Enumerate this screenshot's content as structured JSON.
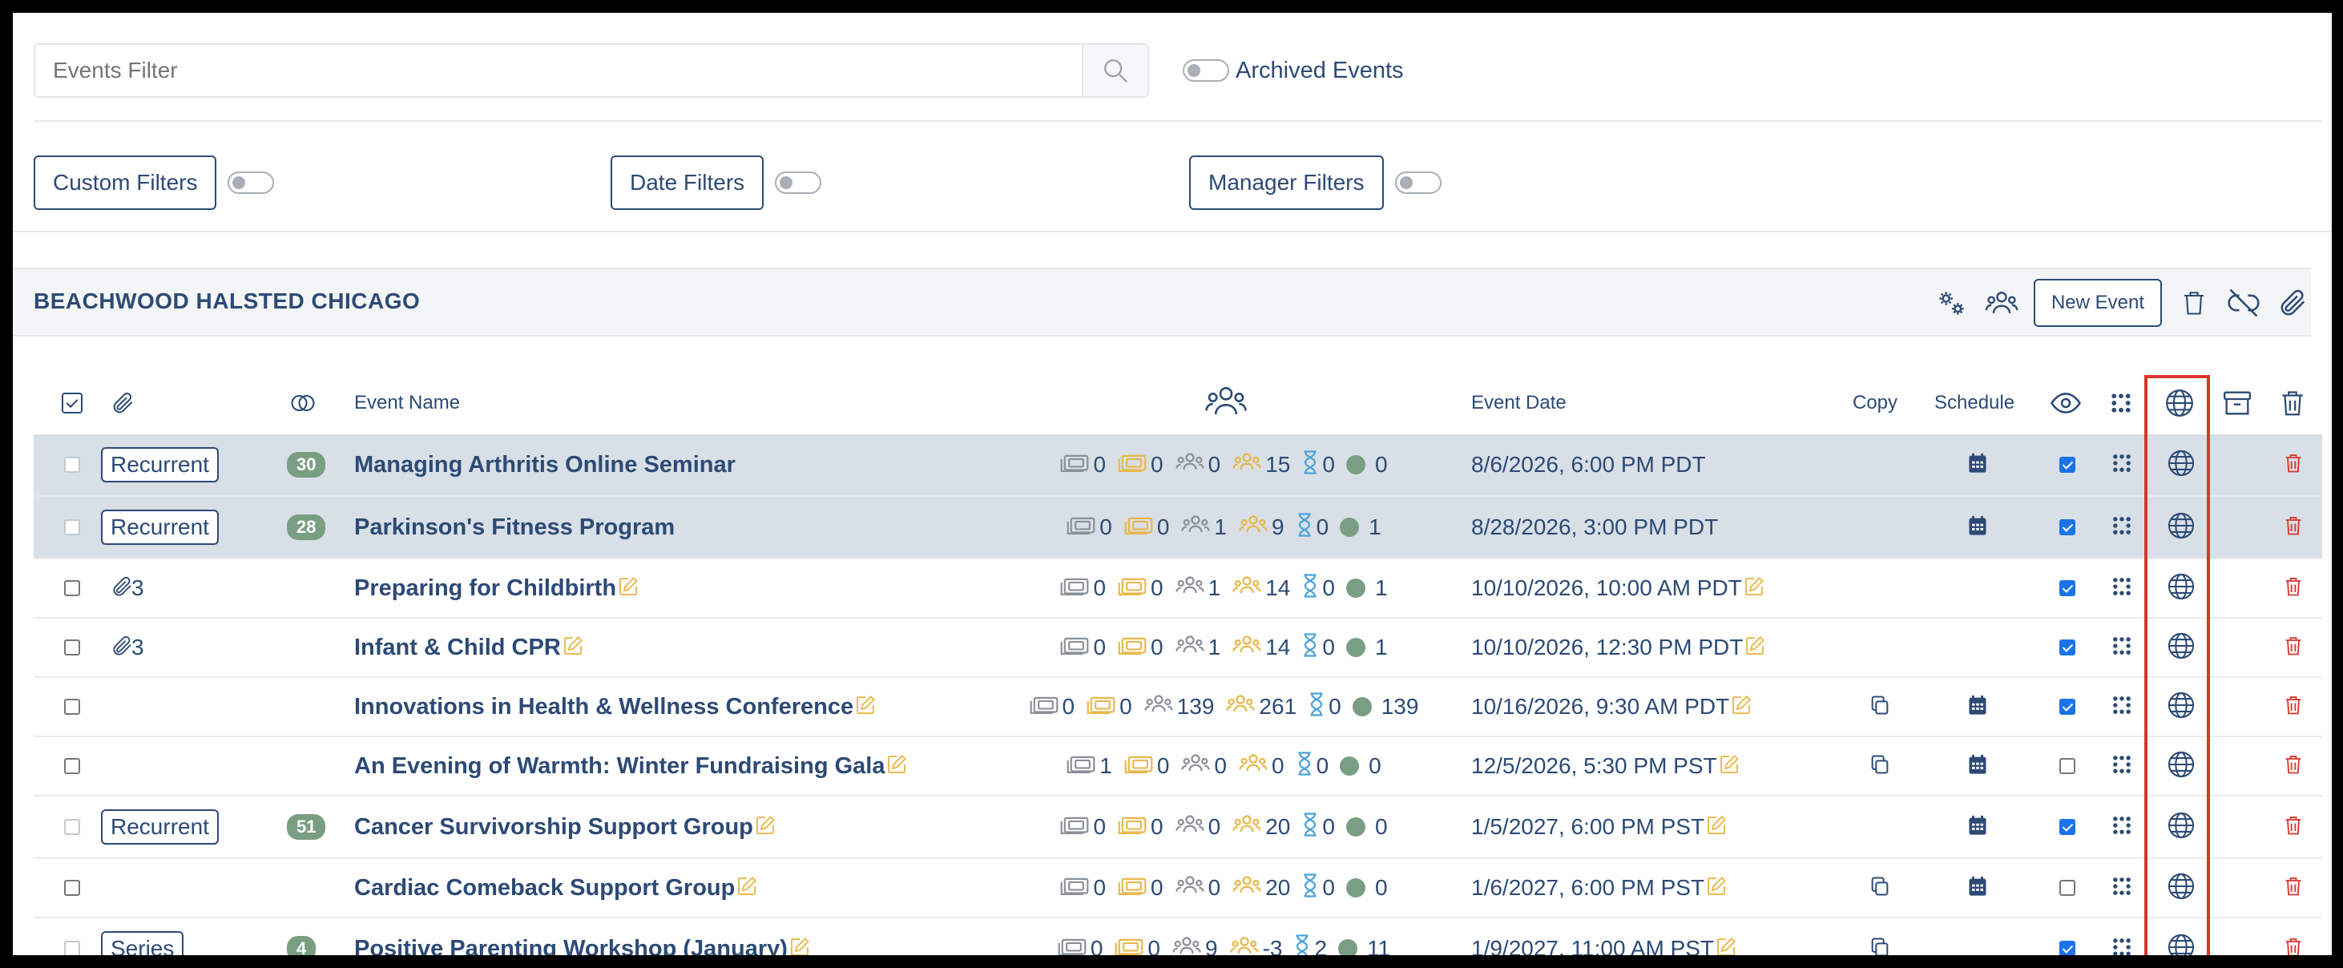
{
  "filters": {
    "search_placeholder": "Events Filter",
    "archived_label": "Archived Events",
    "custom_filters": "Custom Filters",
    "date_filters": "Date Filters",
    "manager_filters": "Manager Filters"
  },
  "section": {
    "title": "BEACHWOOD HALSTED CHICAGO",
    "new_event": "New Event"
  },
  "columns": {
    "event_name": "Event Name",
    "event_date": "Event Date",
    "copy": "Copy",
    "schedule": "Schedule"
  },
  "colors": {
    "text": "#2c4a75",
    "accent_green": "#7a9e82",
    "ticket_gold": "#e8b84a",
    "hourglass_blue": "#4aa3d8",
    "delete_red": "#d9362b",
    "highlight_row": "#d9dfe7"
  },
  "rows": [
    {
      "tag": "Recurrent",
      "count": "30",
      "name": "Managing Arthritis Online Seminar",
      "s1": "0",
      "s2": "0",
      "s3": "0",
      "s4": "15",
      "s5": "0",
      "s6": "0",
      "date": "8/6/2026, 6:00 PM PDT",
      "checked": true,
      "copy": false,
      "schedule": true,
      "highlight": true,
      "editable": false,
      "attach": false
    },
    {
      "tag": "Recurrent",
      "count": "28",
      "name": "Parkinson's Fitness Program",
      "s1": "0",
      "s2": "0",
      "s3": "1",
      "s4": "9",
      "s5": "0",
      "s6": "1",
      "date": "8/28/2026, 3:00 PM PDT",
      "checked": true,
      "copy": false,
      "schedule": true,
      "highlight": true,
      "editable": false,
      "attach": false
    },
    {
      "tag": "",
      "count": "",
      "name": "Preparing for Childbirth",
      "s1": "0",
      "s2": "0",
      "s3": "1",
      "s4": "14",
      "s5": "0",
      "s6": "1",
      "date": "10/10/2026, 10:00 AM PDT",
      "checked": true,
      "copy": false,
      "schedule": false,
      "highlight": false,
      "editable": true,
      "attach": true,
      "attach_count": "3"
    },
    {
      "tag": "",
      "count": "",
      "name": "Infant & Child CPR",
      "s1": "0",
      "s2": "0",
      "s3": "1",
      "s4": "14",
      "s5": "0",
      "s6": "1",
      "date": "10/10/2026, 12:30 PM PDT",
      "checked": true,
      "copy": false,
      "schedule": false,
      "highlight": false,
      "editable": true,
      "attach": true,
      "attach_count": "3"
    },
    {
      "tag": "",
      "count": "",
      "name": "Innovations in Health & Wellness Conference",
      "s1": "0",
      "s2": "0",
      "s3": "139",
      "s4": "261",
      "s5": "0",
      "s6": "139",
      "date": "10/16/2026, 9:30 AM PDT",
      "checked": true,
      "copy": true,
      "schedule": true,
      "highlight": false,
      "editable": true,
      "attach": false
    },
    {
      "tag": "",
      "count": "",
      "name": "An Evening of Warmth: Winter Fundraising Gala",
      "s1": "1",
      "s2": "0",
      "s3": "0",
      "s4": "0",
      "s5": "0",
      "s6": "0",
      "date": "12/5/2026, 5:30 PM PST",
      "checked": false,
      "copy": true,
      "schedule": true,
      "highlight": false,
      "editable": true,
      "attach": false
    },
    {
      "tag": "Recurrent",
      "count": "51",
      "name": "Cancer Survivorship Support Group",
      "s1": "0",
      "s2": "0",
      "s3": "0",
      "s4": "20",
      "s5": "0",
      "s6": "0",
      "date": "1/5/2027, 6:00 PM PST",
      "checked": true,
      "copy": false,
      "schedule": true,
      "highlight": false,
      "editable": true,
      "attach": false
    },
    {
      "tag": "",
      "count": "",
      "name": "Cardiac Comeback Support Group",
      "s1": "0",
      "s2": "0",
      "s3": "0",
      "s4": "20",
      "s5": "0",
      "s6": "0",
      "date": "1/6/2027, 6:00 PM PST",
      "checked": false,
      "copy": true,
      "schedule": true,
      "highlight": false,
      "editable": true,
      "attach": false
    },
    {
      "tag": "Series",
      "count": "4",
      "name": "Positive Parenting Workshop (January)",
      "s1": "0",
      "s2": "0",
      "s3": "9",
      "s4": "-3",
      "s5": "2",
      "s6": "11",
      "date": "1/9/2027, 11:00 AM PST",
      "checked": true,
      "copy": true,
      "schedule": false,
      "highlight": false,
      "editable": true,
      "attach": false
    }
  ]
}
